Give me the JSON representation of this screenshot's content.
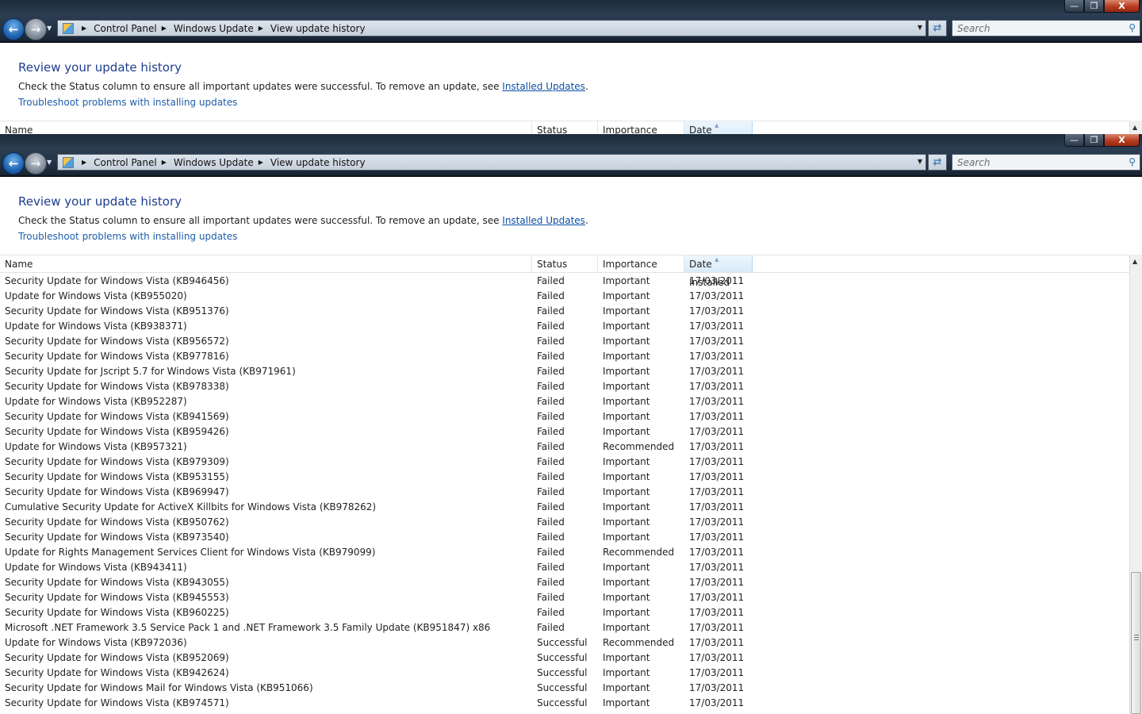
{
  "caption_buttons": {
    "minimize": "—",
    "maximize": "❐",
    "close": "X"
  },
  "breadcrumb": [
    "Control Panel",
    "Windows Update",
    "View update history"
  ],
  "search": {
    "placeholder": "Search"
  },
  "content": {
    "title": "Review your update history",
    "description_prefix": "Check the Status column to ensure all important updates were successful. To remove an update, see ",
    "installed_updates_link": "Installed Updates",
    "description_suffix": ".",
    "troubleshoot_link": "Troubleshoot problems with installing updates"
  },
  "columns": {
    "name": "Name",
    "status": "Status",
    "importance": "Importance",
    "date": "Date Installed"
  },
  "rows": [
    {
      "name": "Security Update for Windows Vista (KB946456)",
      "status": "Failed",
      "importance": "Important",
      "date": "17/03/2011"
    },
    {
      "name": "Update for Windows Vista (KB955020)",
      "status": "Failed",
      "importance": "Important",
      "date": "17/03/2011"
    },
    {
      "name": "Security Update for Windows Vista (KB951376)",
      "status": "Failed",
      "importance": "Important",
      "date": "17/03/2011"
    },
    {
      "name": "Update for Windows Vista (KB938371)",
      "status": "Failed",
      "importance": "Important",
      "date": "17/03/2011"
    },
    {
      "name": "Security Update for Windows Vista (KB956572)",
      "status": "Failed",
      "importance": "Important",
      "date": "17/03/2011"
    },
    {
      "name": "Security Update for Windows Vista (KB977816)",
      "status": "Failed",
      "importance": "Important",
      "date": "17/03/2011"
    },
    {
      "name": "Security Update for Jscript 5.7 for Windows Vista (KB971961)",
      "status": "Failed",
      "importance": "Important",
      "date": "17/03/2011"
    },
    {
      "name": "Security Update for Windows Vista (KB978338)",
      "status": "Failed",
      "importance": "Important",
      "date": "17/03/2011"
    },
    {
      "name": "Update for Windows Vista (KB952287)",
      "status": "Failed",
      "importance": "Important",
      "date": "17/03/2011"
    },
    {
      "name": "Security Update for Windows Vista (KB941569)",
      "status": "Failed",
      "importance": "Important",
      "date": "17/03/2011"
    },
    {
      "name": "Security Update for Windows Vista (KB959426)",
      "status": "Failed",
      "importance": "Important",
      "date": "17/03/2011"
    },
    {
      "name": "Update for Windows Vista (KB957321)",
      "status": "Failed",
      "importance": "Recommended",
      "date": "17/03/2011"
    },
    {
      "name": "Security Update for Windows Vista (KB979309)",
      "status": "Failed",
      "importance": "Important",
      "date": "17/03/2011"
    },
    {
      "name": "Security Update for Windows Vista (KB953155)",
      "status": "Failed",
      "importance": "Important",
      "date": "17/03/2011"
    },
    {
      "name": "Security Update for Windows Vista (KB969947)",
      "status": "Failed",
      "importance": "Important",
      "date": "17/03/2011"
    },
    {
      "name": "Cumulative Security Update for ActiveX Killbits for Windows Vista (KB978262)",
      "status": "Failed",
      "importance": "Important",
      "date": "17/03/2011"
    },
    {
      "name": "Security Update for Windows Vista (KB950762)",
      "status": "Failed",
      "importance": "Important",
      "date": "17/03/2011"
    },
    {
      "name": "Security Update for Windows Vista (KB973540)",
      "status": "Failed",
      "importance": "Important",
      "date": "17/03/2011"
    },
    {
      "name": "Update for Rights Management Services Client for Windows Vista (KB979099)",
      "status": "Failed",
      "importance": "Recommended",
      "date": "17/03/2011"
    },
    {
      "name": "Update for Windows Vista (KB943411)",
      "status": "Failed",
      "importance": "Important",
      "date": "17/03/2011"
    },
    {
      "name": "Security Update for Windows Vista (KB943055)",
      "status": "Failed",
      "importance": "Important",
      "date": "17/03/2011"
    },
    {
      "name": "Security Update for Windows Vista (KB945553)",
      "status": "Failed",
      "importance": "Important",
      "date": "17/03/2011"
    },
    {
      "name": "Security Update for Windows Vista (KB960225)",
      "status": "Failed",
      "importance": "Important",
      "date": "17/03/2011"
    },
    {
      "name": "Microsoft .NET Framework 3.5 Service Pack 1 and .NET Framework 3.5 Family Update (KB951847) x86",
      "status": "Failed",
      "importance": "Important",
      "date": "17/03/2011"
    },
    {
      "name": "Update for Windows Vista (KB972036)",
      "status": "Successful",
      "importance": "Recommended",
      "date": "17/03/2011"
    },
    {
      "name": "Security Update for Windows Vista (KB952069)",
      "status": "Successful",
      "importance": "Important",
      "date": "17/03/2011"
    },
    {
      "name": "Security Update for Windows Vista (KB942624)",
      "status": "Successful",
      "importance": "Important",
      "date": "17/03/2011"
    },
    {
      "name": "Security Update for Windows Mail for Windows Vista (KB951066)",
      "status": "Successful",
      "importance": "Important",
      "date": "17/03/2011"
    },
    {
      "name": "Security Update for Windows Vista (KB974571)",
      "status": "Successful",
      "importance": "Important",
      "date": "17/03/2011"
    }
  ],
  "icons": {
    "back": "back-arrow-icon",
    "forward": "forward-arrow-icon",
    "refresh": "refresh-icon",
    "search": "search-icon",
    "location": "control-panel-icon"
  },
  "colors": {
    "title": "#1e3d8f",
    "link": "#0b4fa8",
    "chrome": "#223246"
  }
}
